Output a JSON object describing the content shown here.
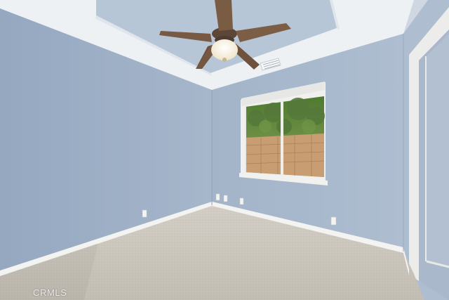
{
  "watermark": {
    "text": "CRMLS"
  },
  "palette": {
    "wall_left": "#9fb1c8",
    "wall_back": "#a9b9cd",
    "wall_right": "#aebdd0",
    "ceiling": "#eef1f4",
    "tray_ceiling": "#b7c6d6",
    "carpet": "#cbc6bd",
    "baseboard": "#f3f3f1",
    "trim": "#eeeeec",
    "fan_blade": "#7a5b44",
    "fan_light": "#f7f1e2",
    "block_wall": "#c99d72",
    "foliage": "#5f7f3a"
  }
}
